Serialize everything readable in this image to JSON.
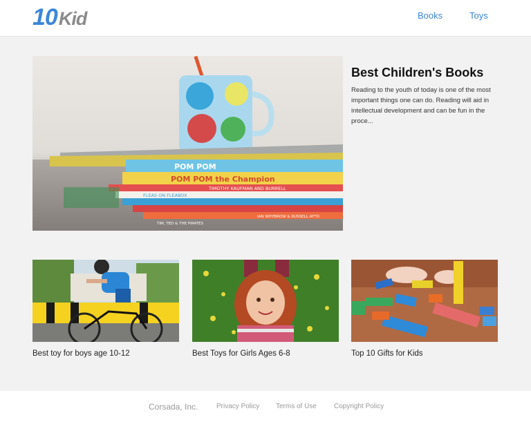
{
  "header": {
    "logo_number": "10",
    "logo_word": "Kid",
    "nav": [
      "Books",
      "Toys"
    ]
  },
  "featured": {
    "title": "Best Children's Books",
    "excerpt": "Reading to the youth of today is one of the most important things one can do. Reading will aid in intellectual development and can be fun in the proce...",
    "image_alt": "Stack of children's books with a mug",
    "book_spines": [
      "POM POM",
      "POM POM the Champion",
      "TIMOTHY KAUFMAN AND BURRELL",
      "FLEAS ON FLEABOX",
      "TIM, TED & THE PIRATES",
      "IAN WHYBROW & RUSSELL AYTO"
    ]
  },
  "cards": [
    {
      "title": "Best toy for boys age 10-12",
      "image_alt": "Boy riding a bicycle"
    },
    {
      "title": "Best Toys for Girls Ages 6-8",
      "image_alt": "Girl with red hair lying in grass"
    },
    {
      "title": "Top 10 Gifts for Kids",
      "image_alt": "Colorful wooden blocks"
    }
  ],
  "footer": {
    "company": "Corsada, Inc.",
    "links": [
      "Privacy Policy",
      "Terms of Use",
      "Copyright Policy"
    ]
  },
  "colors": {
    "accent": "#3b86d9",
    "background": "#f2f2f2",
    "header_bg": "#ffffff"
  }
}
